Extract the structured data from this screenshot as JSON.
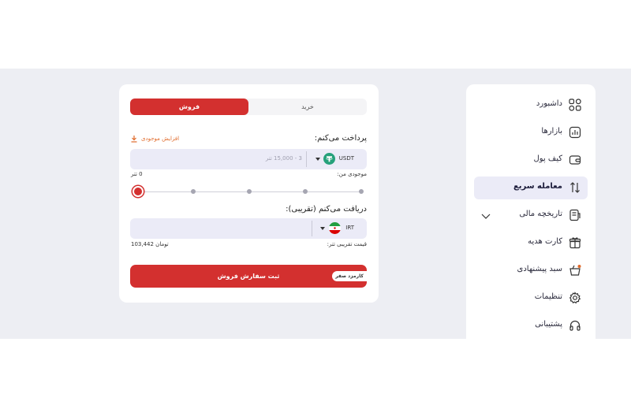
{
  "sidebar": {
    "items": [
      {
        "label": "داشبورد",
        "icon": "grid-icon"
      },
      {
        "label": "بازارها",
        "icon": "chart-icon"
      },
      {
        "label": "کیف پول",
        "icon": "wallet-icon"
      },
      {
        "label": "معامله سریع",
        "icon": "swap-icon",
        "active": true
      },
      {
        "label": "تاریخچه مالی",
        "icon": "history-icon"
      },
      {
        "label": "کارت هدیه",
        "icon": "gift-icon"
      },
      {
        "label": "سبد پیشنهادی",
        "icon": "basket-icon"
      },
      {
        "label": "تنظیمات",
        "icon": "gear-icon"
      },
      {
        "label": "پشتیبانی",
        "icon": "headset-icon"
      }
    ]
  },
  "trade": {
    "tabs": {
      "sell": "فروش",
      "buy": "خرید"
    },
    "pay": {
      "title": "پرداخت می‌کنم:",
      "add_balance": "افزایش موجودی",
      "currency": "USDT",
      "placeholder": "3 - 15,000 تتر",
      "balance_label": "موجودی من:",
      "balance_value": "0 تتر"
    },
    "slider": {
      "value_fraction": 0,
      "steps": 5
    },
    "receive": {
      "title": "دریافت می‌کنم (تقریبی):",
      "currency": "IRT",
      "price_label": "قیمت تقریبی تتر:",
      "price_value": "103,442 تومان"
    },
    "submit": {
      "label": "ثبت سفارش فروش",
      "badge": "کارمزد صفر"
    }
  },
  "colors": {
    "accent": "#d3302f",
    "tether": "#26a17b",
    "active_bg": "#ebebf7"
  }
}
